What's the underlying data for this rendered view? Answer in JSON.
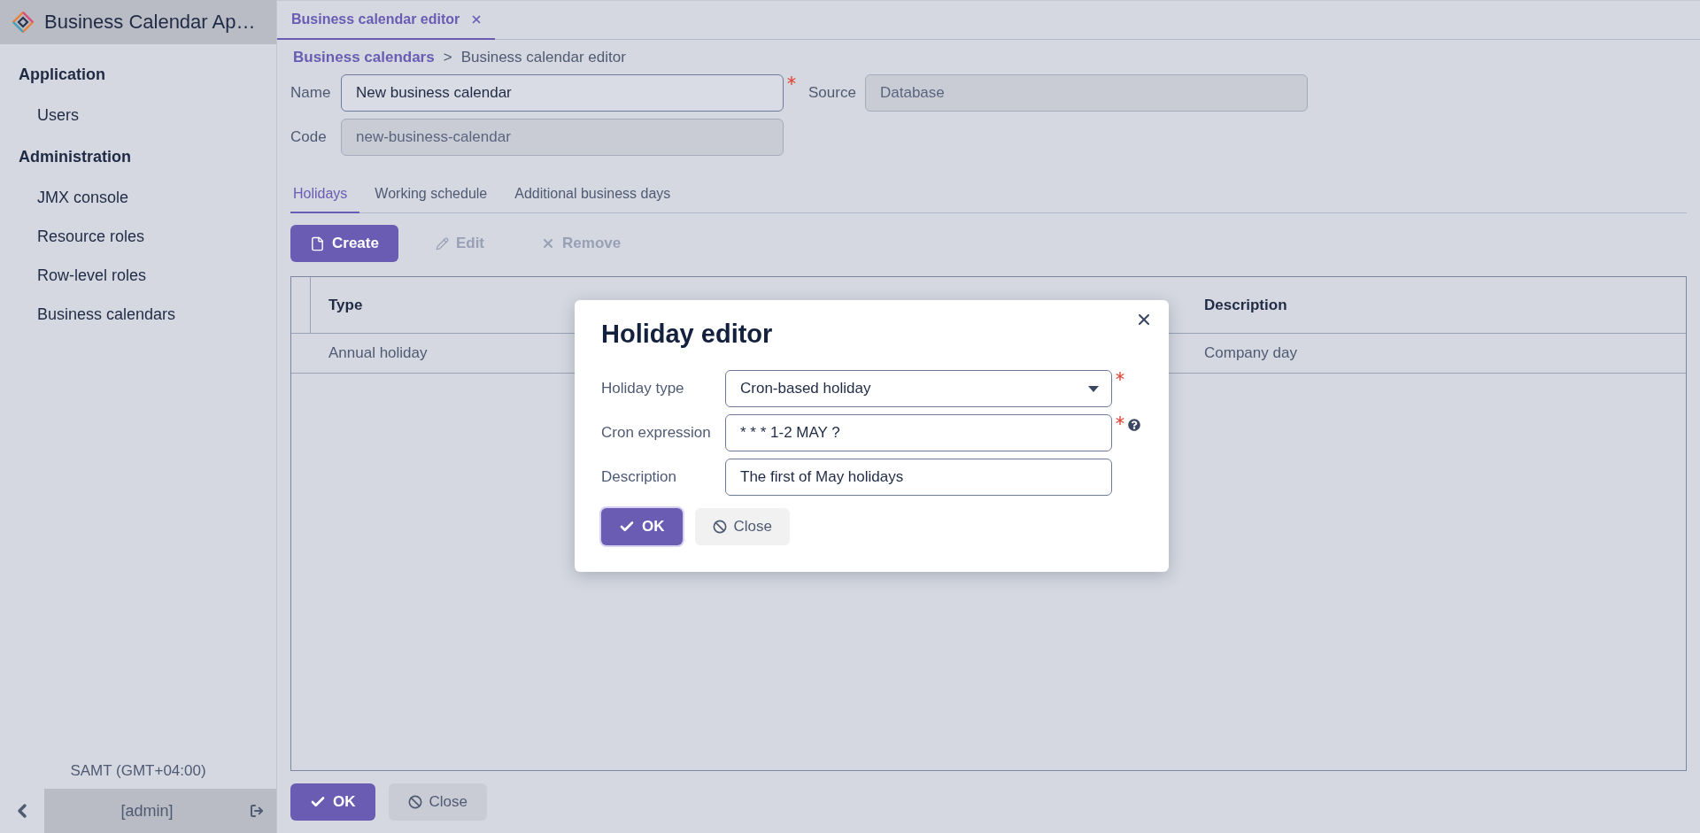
{
  "app": {
    "title": "Business Calendar Ap…"
  },
  "sidebar": {
    "sections": [
      {
        "title": "Application",
        "items": [
          {
            "label": "Users",
            "selected": false
          }
        ]
      },
      {
        "title": "Administration",
        "items": [
          {
            "label": "JMX console",
            "selected": false
          },
          {
            "label": "Resource roles",
            "selected": false
          },
          {
            "label": "Row-level roles",
            "selected": false
          },
          {
            "label": "Business calendars",
            "selected": false
          }
        ]
      }
    ],
    "timezone": "SAMT (GMT+04:00)",
    "user": "[admin]"
  },
  "tab": {
    "label": "Business calendar editor"
  },
  "breadcrumb": {
    "link": "Business calendars",
    "separator": ">",
    "current": "Business calendar editor"
  },
  "form": {
    "fields": [
      {
        "label": "Name",
        "value": "New business calendar",
        "required": true,
        "disabled": false
      },
      {
        "label": "Source",
        "value": "Database",
        "required": false,
        "disabled": true
      },
      {
        "label": "Code",
        "value": "new-business-calendar",
        "required": false,
        "disabled": true
      }
    ]
  },
  "tabs": [
    {
      "label": "Holidays",
      "selected": true
    },
    {
      "label": "Working schedule",
      "selected": false
    },
    {
      "label": "Additional business days",
      "selected": false
    }
  ],
  "toolbar": [
    {
      "label": "Create",
      "disabled": false
    },
    {
      "label": "Edit",
      "disabled": true
    },
    {
      "label": "Remove",
      "disabled": true
    }
  ],
  "table": {
    "columns": [
      "Type",
      "Description"
    ],
    "rows": [
      {
        "type": "Annual holiday",
        "description": "Company day"
      }
    ]
  },
  "dialog": {
    "title": "Holiday editor",
    "fields": [
      {
        "kind": "select",
        "label": "Holiday type",
        "value": "Cron-based holiday",
        "required": true,
        "help": false
      },
      {
        "kind": "text",
        "label": "Cron expression",
        "value": "* * * 1-2 MAY ?",
        "required": true,
        "help": true
      },
      {
        "kind": "text",
        "label": "Description",
        "value": "The first of May holidays",
        "required": false,
        "help": false
      }
    ],
    "buttons": [
      {
        "label": "OK",
        "kind": "primary"
      },
      {
        "label": "Close",
        "kind": "secondary"
      }
    ]
  },
  "footer_buttons": [
    {
      "label": "OK",
      "kind": "primary"
    },
    {
      "label": "Close",
      "kind": "secondary"
    }
  ]
}
